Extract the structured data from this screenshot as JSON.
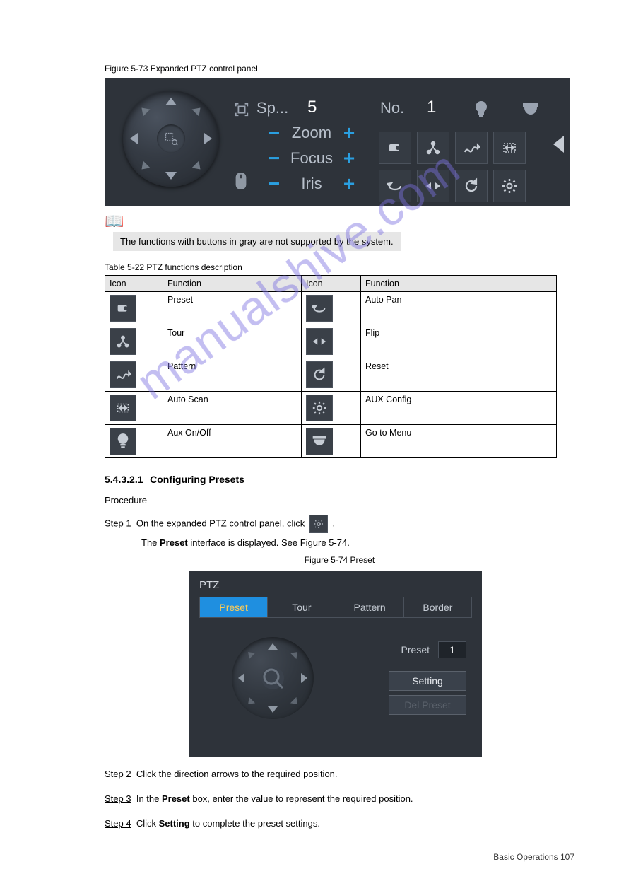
{
  "watermark": "manualshive.com",
  "figure73": {
    "caption": "Figure 5-73 Expanded PTZ control panel",
    "speed_label": "Sp...",
    "speed_value": "5",
    "no_label": "No.",
    "no_value": "1",
    "rows": {
      "zoom": {
        "label": "Zoom",
        "minus": "−",
        "plus": "+"
      },
      "focus": {
        "label": "Focus",
        "minus": "−",
        "plus": "+"
      },
      "iris": {
        "label": "Iris",
        "minus": "−",
        "plus": "+"
      }
    }
  },
  "note_text": "The functions with buttons in gray are not supported by the system.",
  "table": {
    "caption": "Table 5-22 PTZ functions description",
    "headers": [
      "Icon",
      "Function",
      "Icon",
      "Function"
    ],
    "rows": [
      {
        "f1": "Preset",
        "f2": "Auto Pan"
      },
      {
        "f1": "Tour",
        "f2": "Flip"
      },
      {
        "f1": "Pattern",
        "f2": "Reset"
      },
      {
        "f1": "Auto Scan",
        "f2": "AUX Config"
      },
      {
        "f1": "Aux On/Off",
        "f2": "Go to Menu"
      }
    ]
  },
  "section": {
    "number": "5.4.3.2.1",
    "title": "Configuring Presets",
    "procedure_line_1": "Procedure",
    "step1_label": "Step 1",
    "step1_text_a": "On the expanded PTZ control panel, click ",
    "step1_text_b": ".",
    "step1_result": "The Preset interface is displayed. See Figure 5-74."
  },
  "figure74": {
    "caption": "Figure 5-74 Preset",
    "title": "PTZ",
    "tabs": [
      "Preset",
      "Tour",
      "Pattern",
      "Border"
    ],
    "preset_label": "Preset",
    "preset_value": "1",
    "setting_btn": "Setting",
    "del_btn": "Del Preset"
  },
  "step2": {
    "label": "Step 2",
    "text": "Click the direction arrows to the required position."
  },
  "step3": {
    "label": "Step 3",
    "text_a": "In the ",
    "text_b": "Preset",
    "text_c": " box, enter the value to represent the required position."
  },
  "step4": {
    "label": "Step 4",
    "text_a": "Click ",
    "text_b": "Setting",
    "text_c": " to complete the preset settings."
  },
  "page_number": "Basic Operations 107"
}
